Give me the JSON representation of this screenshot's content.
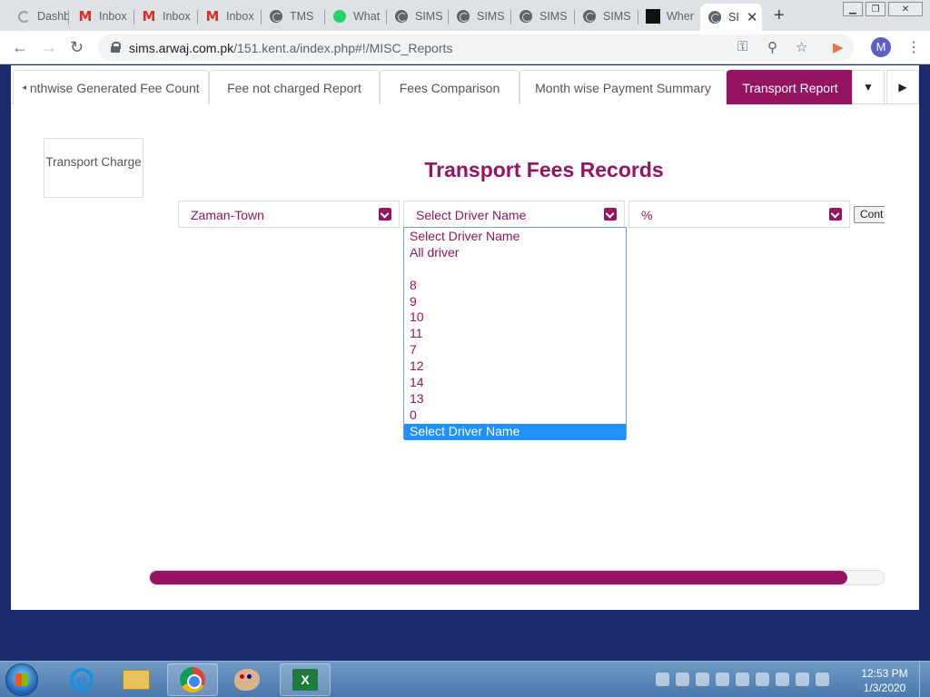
{
  "browser": {
    "tabs": [
      {
        "title": "Dashb",
        "icon": "loading-spinner-icon"
      },
      {
        "title": "Inbox",
        "icon": "gmail-icon"
      },
      {
        "title": "Inbox",
        "icon": "gmail-icon"
      },
      {
        "title": "Inbox",
        "icon": "gmail-icon"
      },
      {
        "title": "TMS",
        "icon": "globe-icon"
      },
      {
        "title": "What",
        "icon": "whatsapp-icon"
      },
      {
        "title": "SIMS",
        "icon": "globe-icon"
      },
      {
        "title": "SIMS",
        "icon": "globe-icon"
      },
      {
        "title": "SIMS",
        "icon": "globe-icon"
      },
      {
        "title": "SIMS",
        "icon": "globe-icon"
      },
      {
        "title": "Wher",
        "icon": "site-favicon-icon"
      },
      {
        "title": "SI",
        "icon": "globe-icon",
        "active": true
      }
    ],
    "url_host": "sims.arwaj.com.pk",
    "url_path": "/151.kent.a/index.php#!/MISC_Reports",
    "profile_initial": "M"
  },
  "app": {
    "accent_color": "#941462",
    "tabs": [
      {
        "label": "nthwise Generated Fee Count"
      },
      {
        "label": "Fee not charged Report"
      },
      {
        "label": "Fees Comparison"
      },
      {
        "label": "Month wise Payment Summary"
      },
      {
        "label": "Transport Report",
        "active": true
      }
    ],
    "side_card_label": "Transport Charge",
    "heading": "Transport Fees Records",
    "filters": {
      "town": "Zaman-Town",
      "driver": "Select Driver Name",
      "percent": "%"
    },
    "continue_label": "Cont",
    "driver_options": [
      "Select Driver Name",
      "All driver",
      "",
      "8",
      "9",
      "10",
      "11",
      "7",
      "12",
      "14",
      "13",
      "0",
      "Select Driver Name"
    ],
    "highlighted_option_index": 12,
    "progress_fraction": 0.95
  },
  "taskbar": {
    "time": "12:53 PM",
    "date": "1/3/2020"
  }
}
